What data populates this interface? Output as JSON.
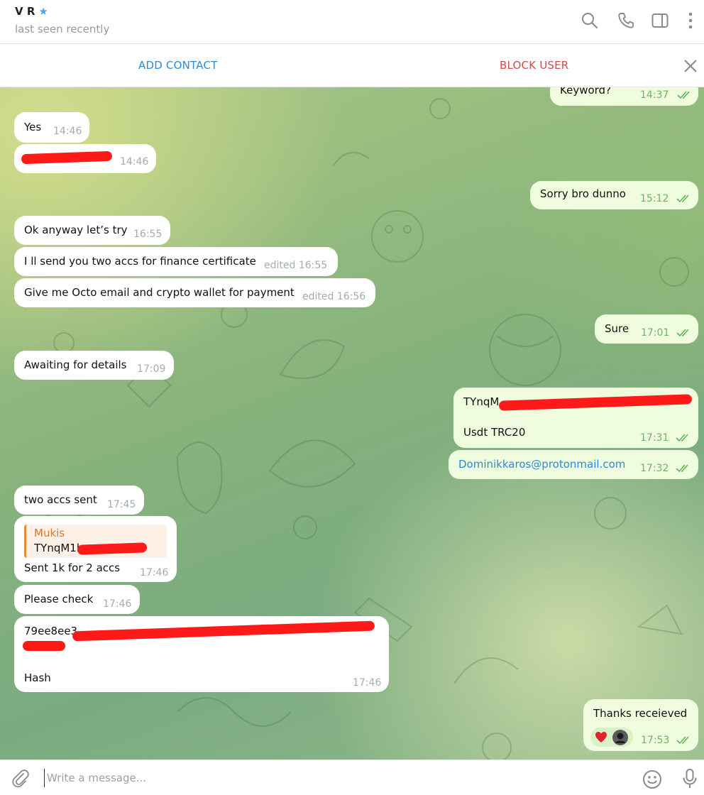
{
  "header": {
    "name": "V R",
    "status": "last seen recently",
    "icons": [
      "search-icon",
      "phone-icon",
      "sidebar-toggle-icon",
      "more-vertical-icon"
    ]
  },
  "actions": {
    "add_contact": "ADD CONTACT",
    "block_user": "BLOCK USER"
  },
  "messages": [
    {
      "dir": "out",
      "text": "Keyword?",
      "time": "14:37",
      "read": true
    },
    {
      "dir": "in",
      "text": "Yes",
      "time": "14:46"
    },
    {
      "dir": "in",
      "text": "",
      "time": "14:46",
      "redacted": true
    },
    {
      "dir": "out",
      "text": "Sorry bro dunno",
      "time": "15:12",
      "read": true
    },
    {
      "dir": "in",
      "text": "Ok anyway let’s try",
      "time": "16:55"
    },
    {
      "dir": "in",
      "text": "I ll send you two accs for finance certificate",
      "time": "edited 16:55"
    },
    {
      "dir": "in",
      "text": "Give me Octo email and crypto wallet for payment",
      "time": "edited 16:56"
    },
    {
      "dir": "out",
      "text": "Sure",
      "time": "17:01",
      "read": true
    },
    {
      "dir": "in",
      "text": "Awaiting for details",
      "time": "17:09"
    },
    {
      "dir": "out",
      "text": "TYnqM",
      "text2": "Usdt TRC20",
      "time": "17:31",
      "read": true,
      "redacted": true
    },
    {
      "dir": "out",
      "text": "Dominikkaros@protonmail.com",
      "time": "17:32",
      "read": true
    },
    {
      "dir": "in",
      "text": "two accs sent",
      "time": "17:45"
    },
    {
      "dir": "in",
      "reply_name": "Mukis",
      "reply_text": "TYnqM1h",
      "text": "Sent 1k for 2 accs",
      "time": "17:46"
    },
    {
      "dir": "in",
      "text": "Please check",
      "time": "17:46"
    },
    {
      "dir": "in",
      "text": "79ee8ee3",
      "text2": "Hash",
      "time": "17:46",
      "redacted": true
    },
    {
      "dir": "out",
      "text": "Thanks receieved",
      "time": "17:53",
      "read": true,
      "reactions": [
        "heart-reaction-icon",
        "user-avatar-icon"
      ]
    }
  ],
  "composer": {
    "placeholder": "Write a message..."
  },
  "colors": {
    "accent": "#2a8bd6",
    "danger": "#d14b4b",
    "outgoing_bubble": "#effdde",
    "incoming_bubble": "#ffffff"
  }
}
